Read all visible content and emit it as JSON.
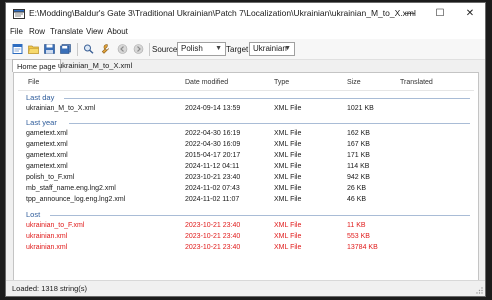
{
  "window": {
    "title": "E:\\Modding\\Baldur's Gate 3\\Traditional Ukrainian\\Patch 7\\Localization\\Ukrainian\\ukrainian_M_to_X.xml",
    "controls": {
      "minimize": "—",
      "maximize": "☐",
      "close": "✕"
    }
  },
  "menu": [
    "File",
    "Row",
    "Translate",
    "View",
    "About"
  ],
  "toolbar": {
    "source_label": "Source",
    "source_value": "Polish",
    "target_label": "Target",
    "target_value": "Ukrainian",
    "icons": [
      "new-file-icon",
      "open-folder-icon",
      "save-icon",
      "save-all-icon",
      "search-icon",
      "wrench-icon",
      "back-icon",
      "forward-icon"
    ]
  },
  "tabs": [
    {
      "label": "Home page",
      "active": true
    },
    {
      "label": "ukrainian_M_to_X.xml",
      "active": false
    }
  ],
  "columns": {
    "file": "File",
    "date": "Date modified",
    "type": "Type",
    "size": "Size",
    "translated": "Translated"
  },
  "groups": [
    {
      "title": "Last day",
      "rows": [
        {
          "file": "ukrainian_M_to_X.xml",
          "date": "2024-09-14 13:59",
          "type": "XML File",
          "size": "1021 KB",
          "translated": ""
        }
      ]
    },
    {
      "title": "Last year",
      "rows": [
        {
          "file": "gametext.xml",
          "date": "2022-04-30 16:19",
          "type": "XML File",
          "size": "162 KB",
          "translated": ""
        },
        {
          "file": "gametext.xml",
          "date": "2022-04-30 16:09",
          "type": "XML File",
          "size": "167 KB",
          "translated": ""
        },
        {
          "file": "gametext.xml",
          "date": "2015-04-17 20:17",
          "type": "XML File",
          "size": "171 KB",
          "translated": ""
        },
        {
          "file": "gametext.xml",
          "date": "2024-11-12 04:11",
          "type": "XML File",
          "size": "114 KB",
          "translated": ""
        },
        {
          "file": "polish_to_F.xml",
          "date": "2023-10-21 23:40",
          "type": "XML File",
          "size": "942 KB",
          "translated": ""
        },
        {
          "file": "mb_staff_name.eng.lng2.xml",
          "date": "2024-11-02 07:43",
          "type": "XML File",
          "size": "26 KB",
          "translated": ""
        },
        {
          "file": "tpp_announce_log.eng.lng2.xml",
          "date": "2024-11-02 11:07",
          "type": "XML File",
          "size": "46 KB",
          "translated": ""
        }
      ]
    },
    {
      "title": "Lost",
      "rows": [
        {
          "file": "ukrainian_to_F.xml",
          "date": "2023-10-21 23:40",
          "type": "XML File",
          "size": "11 KB",
          "translated": ""
        },
        {
          "file": "ukrainian.xml",
          "date": "2023-10-21 23:40",
          "type": "XML File",
          "size": "553 KB",
          "translated": ""
        },
        {
          "file": "ukrainian.xml",
          "date": "2023-10-21 23:40",
          "type": "XML File",
          "size": "13784 KB",
          "translated": ""
        }
      ]
    }
  ],
  "status": {
    "text": "Loaded: 1318 string(s)"
  },
  "colors": {
    "group_title": "#2d5b9a",
    "lost_row": "#e01b1b",
    "accent": "#2d6cc0"
  }
}
